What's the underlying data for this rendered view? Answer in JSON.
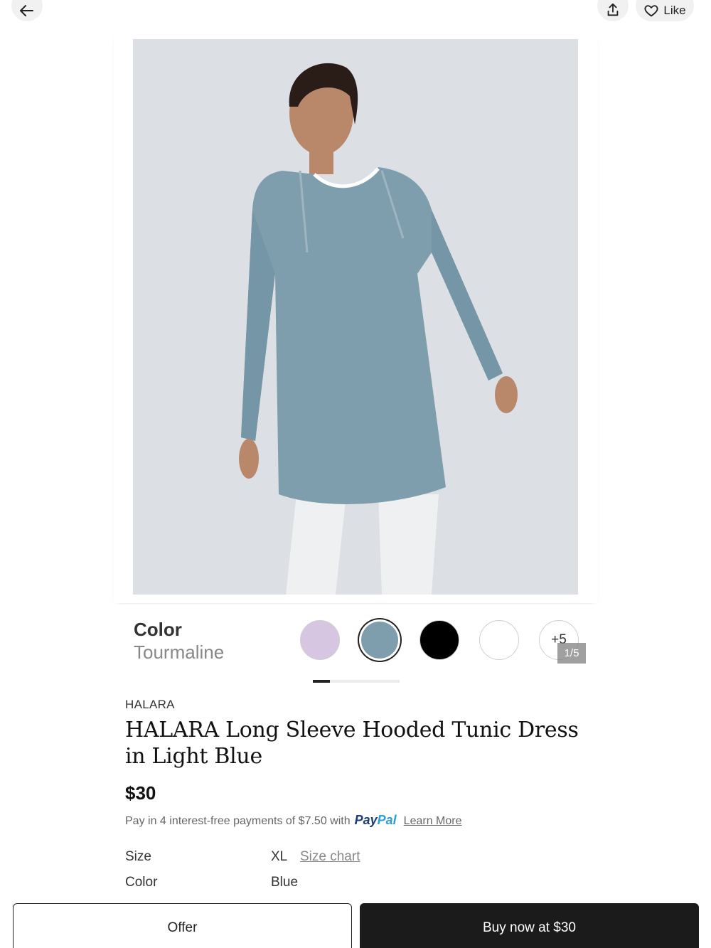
{
  "header": {
    "back_icon": "arrow-left-icon",
    "share_icon": "share-icon",
    "like_icon": "heart-icon",
    "like_label": "Like"
  },
  "image": {
    "description_icon": "product-photo"
  },
  "color_selector": {
    "title": "Color",
    "selected_name": "Tourmaline",
    "swatches": [
      {
        "color": "#d6c6e2"
      },
      {
        "color": "#7f9ead"
      },
      {
        "color": "#000000"
      },
      {
        "color": "#ffffff"
      }
    ],
    "more_label": "+5",
    "counter": "1/5"
  },
  "product": {
    "brand": "HALARA",
    "title": "HALARA Long Sleeve Hooded Tunic Dress in Light Blue",
    "price": "$30",
    "paypal_text": "Pay in 4 interest-free payments of $7.50 with",
    "paypal_pay": "Pay",
    "paypal_pal": "Pal",
    "learn_more": "Learn More"
  },
  "specs": {
    "size_label": "Size",
    "size_value": "XL",
    "size_chart": "Size chart",
    "color_label": "Color",
    "color_value": "Blue"
  },
  "actions": {
    "offer_label": "Offer",
    "buy_label": "Buy now at $30"
  },
  "colors": {
    "accent": "#1b1b1b",
    "image_bg": "#dcdfe3",
    "garment": "#7f9ead"
  }
}
